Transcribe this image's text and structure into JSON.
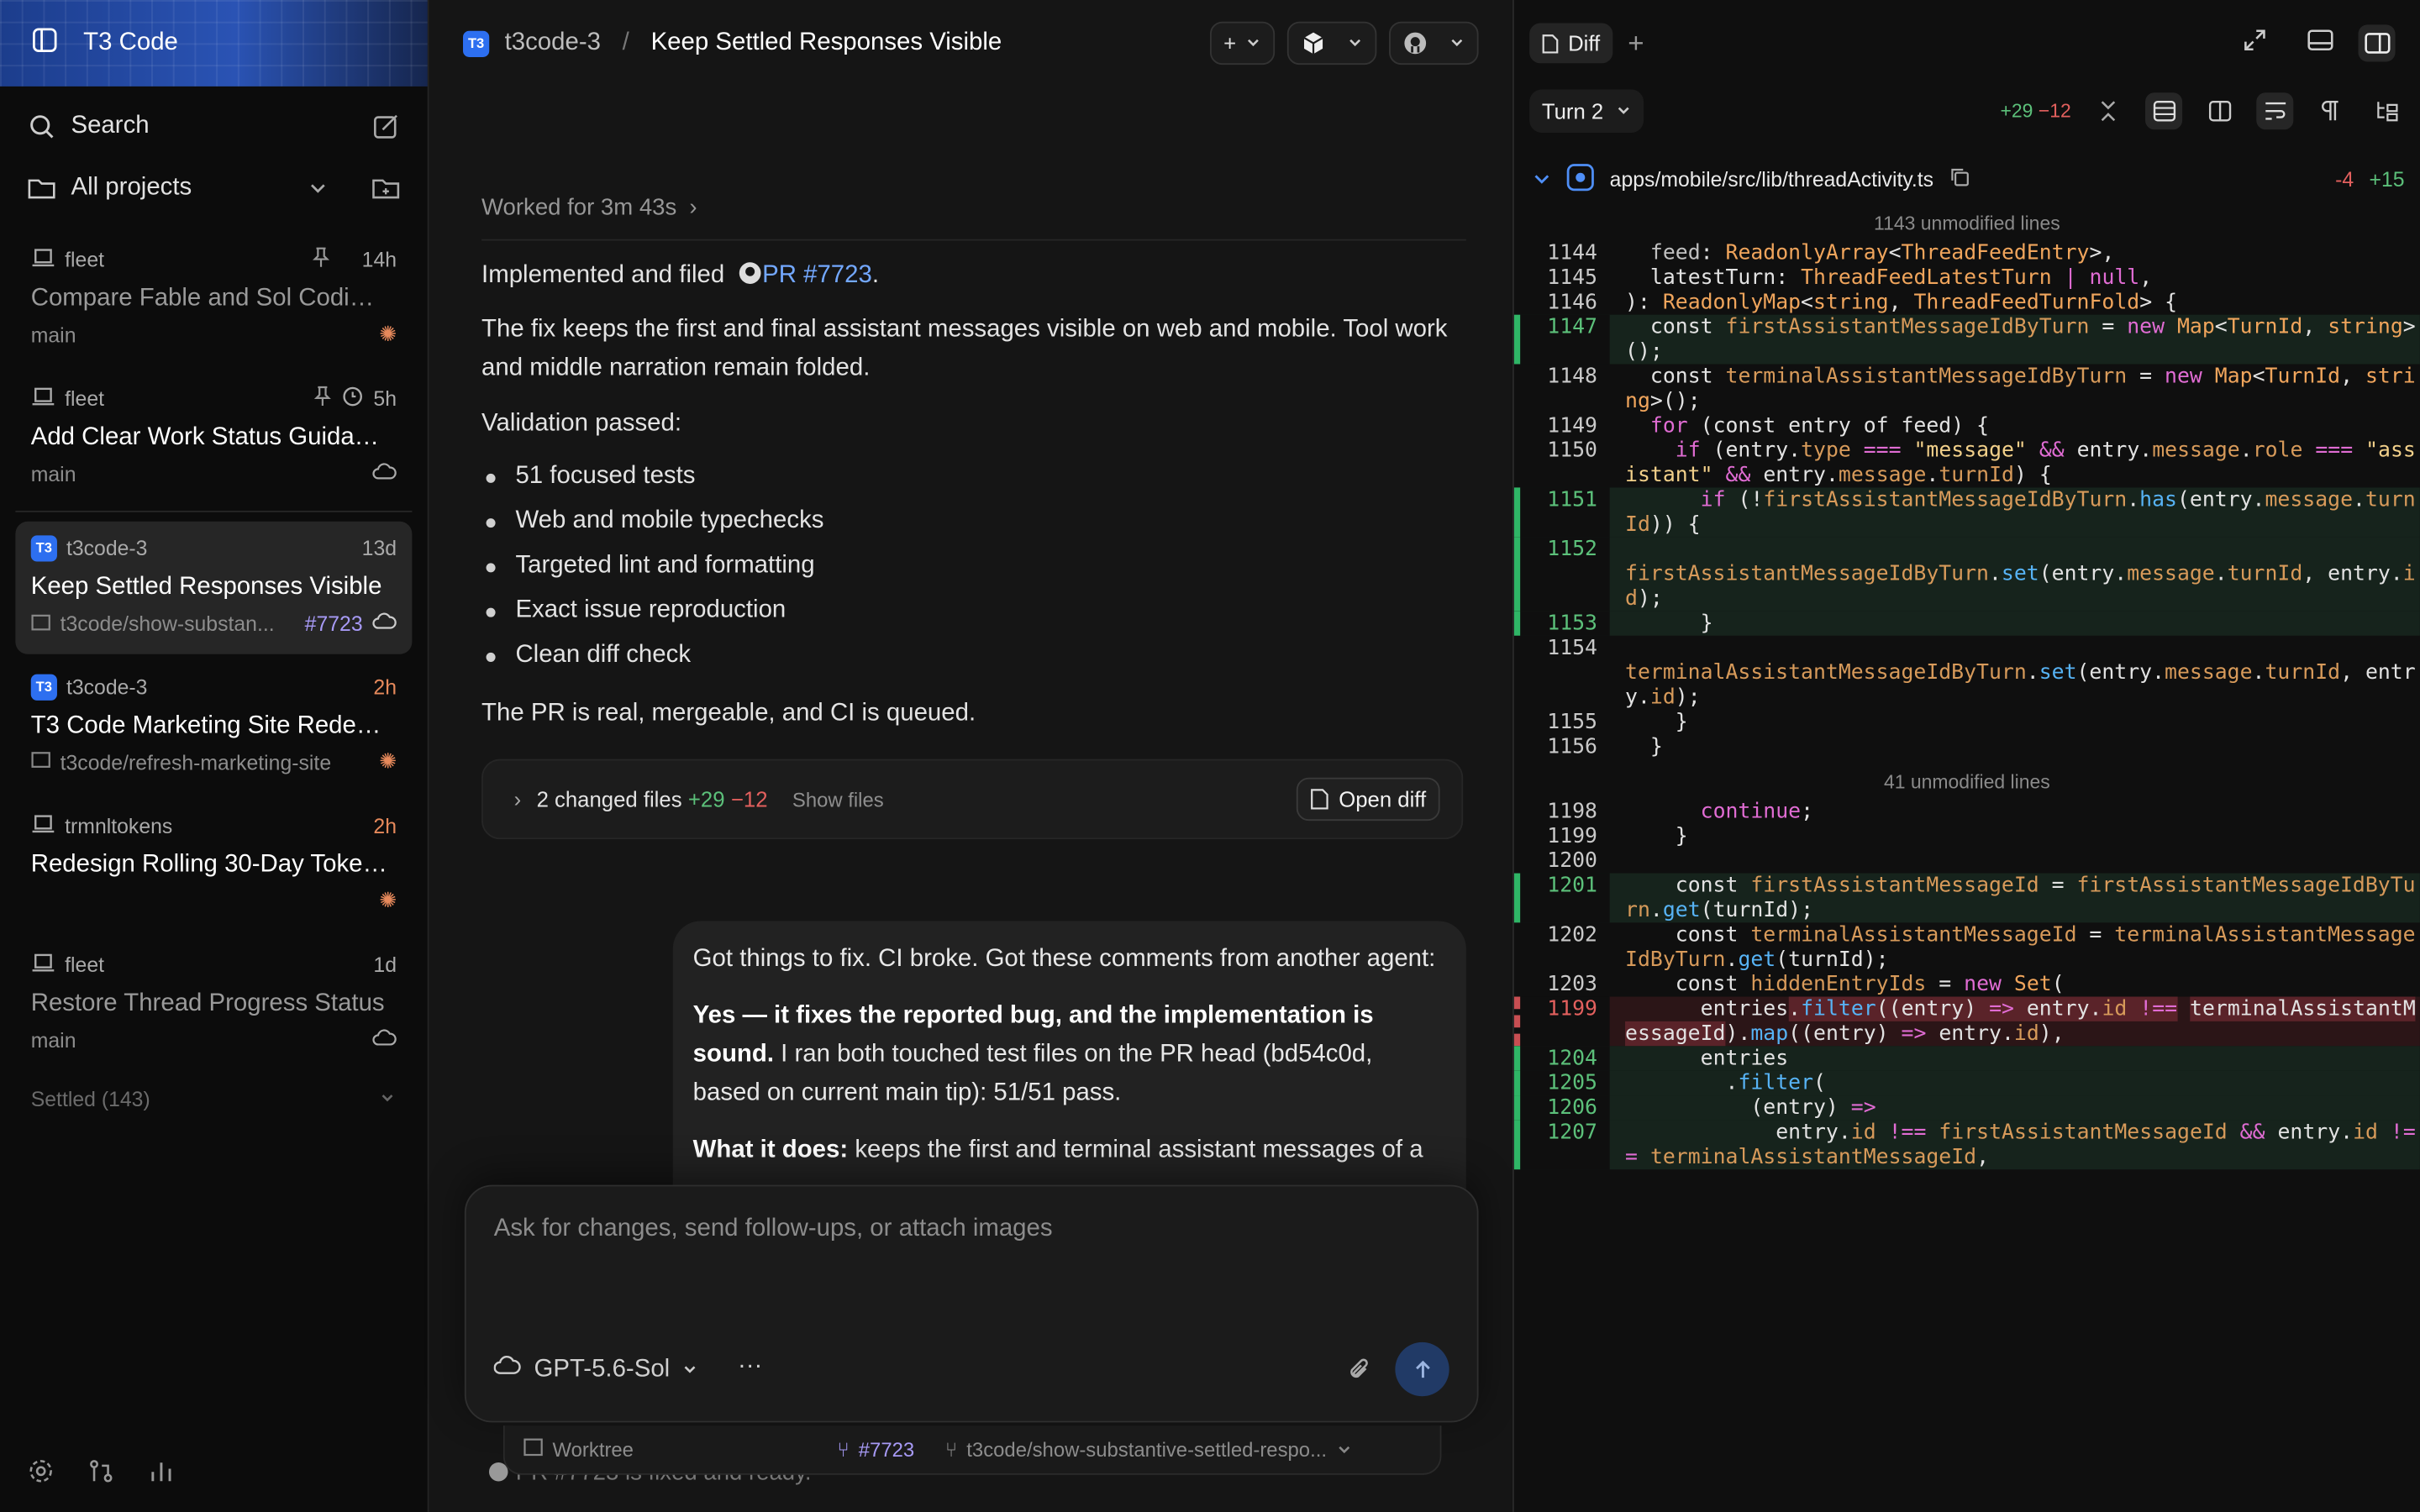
{
  "sidebar": {
    "brand": "T3 Code",
    "search": "Search",
    "projects": "All projects",
    "threads": [
      {
        "project": "fleet",
        "time": "14h",
        "title": "Compare Fable and Sol Coding ...",
        "sub": "main",
        "icon": "laptop-icon",
        "dim": true
      },
      {
        "project": "fleet",
        "time": "5h",
        "title": "Add Clear Work Status Guidance",
        "sub": "main",
        "icon": "laptop-icon",
        "dim": false
      },
      {
        "project": "t3code-3",
        "time": "13d",
        "title": "Keep Settled Responses Visible",
        "sub": "t3code/show-substan...",
        "pr": "#7723",
        "icon": "t3-icon",
        "active": true
      },
      {
        "project": "t3code-3",
        "time": "2h",
        "title": "T3 Code Marketing Site Redesi...",
        "sub": "t3code/refresh-marketing-site",
        "icon": "t3-icon"
      },
      {
        "project": "trmnltokens",
        "time": "2h",
        "title": "Redesign Rolling 30-Day Token...",
        "sub": "",
        "icon": "laptop-icon"
      },
      {
        "project": "fleet",
        "time": "1d",
        "title": "Restore Thread Progress Status",
        "sub": "main",
        "icon": "laptop-icon",
        "dim": true
      }
    ],
    "settled": "Settled (143)"
  },
  "header": {
    "project": "t3code-3",
    "title": "Keep Settled Responses Visible"
  },
  "chat": {
    "worked": "Worked for 3m 43s",
    "implemented": "Implemented and filed",
    "pr_link": "PR #7723",
    "fix": "The fix keeps the first and final assistant messages visible on web and mobile. Tool work and middle narration remain folded.",
    "validation": "Validation passed:",
    "bullets": [
      "51 focused tests",
      "Web and mobile typechecks",
      "Targeted lint and formatting",
      "Exact issue reproduction",
      "Clean diff check"
    ],
    "pr_status": "The PR is real, mergeable, and CI is queued.",
    "changed_files": "2 changed files",
    "added": "+29",
    "removed": "−12",
    "show_files": "Show files",
    "open_diff": "Open diff",
    "user_msg": "Got things to fix. CI broke. Got these comments from another agent:",
    "user_bold": "Yes — it fixes the reported bug, and the implementation is sound.",
    "user_rest": "I ran both touched test files on the PR head (bd54c0d, based on current main tip): 51/51 pass.",
    "what_bold": "What it does:",
    "what_rest": "keeps the first and terminal assistant messages of a",
    "under": "PR #7723 is fixed and ready."
  },
  "composer": {
    "placeholder": "Ask for changes, send follow-ups, or attach images",
    "model": "GPT-5.6-Sol",
    "dots": "···"
  },
  "worktree": {
    "label": "Worktree",
    "pr": "#7723",
    "branch": "t3code/show-substantive-settled-respo..."
  },
  "diff": {
    "tab": "Diff",
    "turn": "Turn 2",
    "added": "+29",
    "removed": "−12",
    "file": "apps/mobile/src/lib/threadActivity.ts",
    "file_removed": "-4",
    "file_added": "+15",
    "unmod1": "1143 unmodified lines",
    "unmod2": "41 unmodified lines"
  },
  "colors": {
    "accent": "#2d6ff0",
    "added": "#5cc07a",
    "removed": "#e3605e",
    "pr": "#a79af5"
  }
}
